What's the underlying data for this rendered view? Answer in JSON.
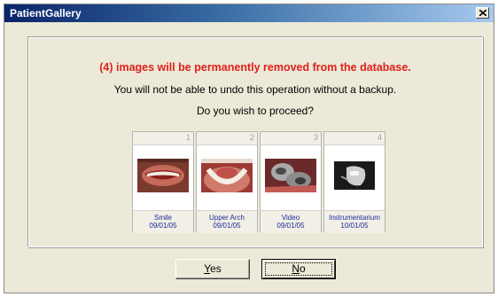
{
  "window": {
    "title": "PatientGallery",
    "close_label": "×"
  },
  "message": {
    "warning": "(4) images will be permanently removed from the database.",
    "undo_note": "You will not be able to undo this operation without a backup.",
    "question": "Do you wish to proceed?"
  },
  "images": [
    {
      "number": "1",
      "name": "Smile",
      "date": "09/01/05",
      "thumb_icon": "smile-photo"
    },
    {
      "number": "2",
      "name": "Upper Arch",
      "date": "09/01/05",
      "thumb_icon": "upper-arch-photo"
    },
    {
      "number": "3",
      "name": "Video",
      "date": "09/01/05",
      "thumb_icon": "video-frame-photo"
    },
    {
      "number": "4",
      "name": "Instrumentarium",
      "date": "10/01/05",
      "thumb_icon": "xray-photo"
    }
  ],
  "buttons": {
    "yes_prefix": "",
    "yes_hotkey": "Y",
    "yes_rest": "es",
    "no_prefix": "",
    "no_hotkey": "N",
    "no_rest": "o"
  },
  "colors": {
    "warning": "#e0201b",
    "caption": "#1a2a9a",
    "dialog_bg": "#ece9d8"
  }
}
